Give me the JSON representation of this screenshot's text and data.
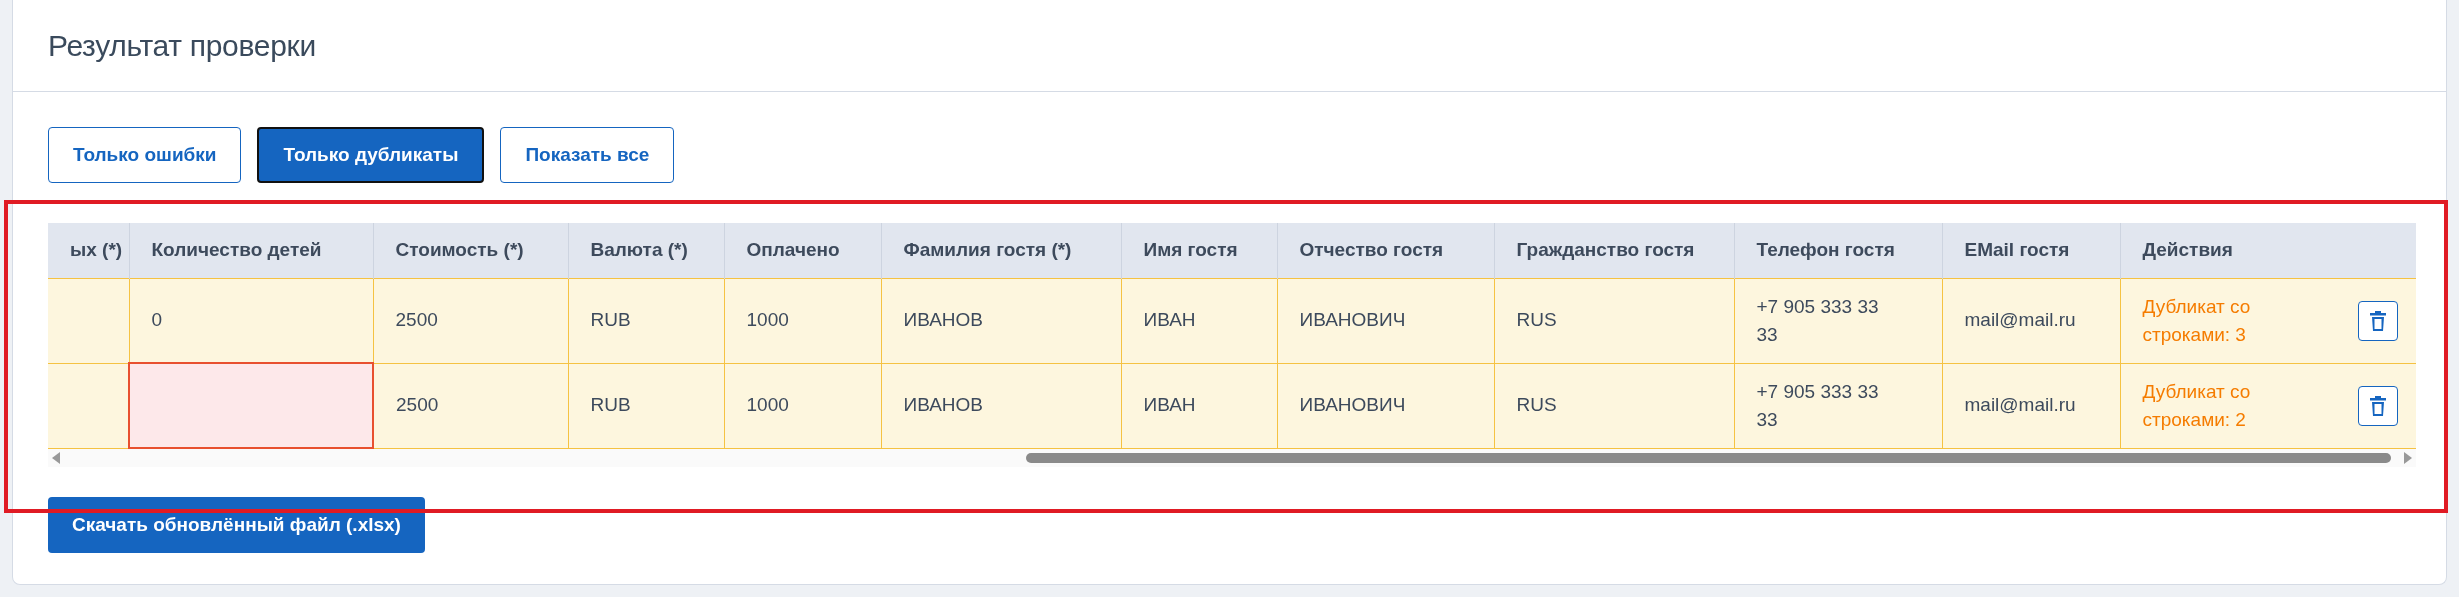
{
  "title": "Результат проверки",
  "filters": [
    {
      "label": "Только ошибки",
      "selected": false
    },
    {
      "label": "Только дубликаты",
      "selected": true
    },
    {
      "label": "Показать все",
      "selected": false
    }
  ],
  "table": {
    "columns": [
      "ых (*)",
      "Количество детей",
      "Стоимость (*)",
      "Валюта (*)",
      "Оплачено",
      "Фамилия гостя (*)",
      "Имя гостя",
      "Отчество гостя",
      "Гражданство гостя",
      "Телефон гостя",
      "EMail гостя",
      "Действия"
    ],
    "rows": [
      {
        "cells": [
          {
            "error": false
          },
          {
            "text": "0",
            "error": false
          },
          {
            "text": "2500",
            "error": false
          },
          {
            "text": "RUB",
            "error": false
          },
          {
            "text": "1000",
            "error": false
          },
          {
            "text": "ИВАНОВ",
            "error": false
          },
          {
            "text": "ИВАН",
            "error": false
          },
          {
            "text": "ИВАНОВИЧ",
            "error": false
          },
          {
            "text": "RUS",
            "error": false
          },
          {
            "text": "+7 905 333 33 33",
            "error": false
          },
          {
            "text": "mail@mail.ru",
            "error": false
          }
        ],
        "status": "Дубликат со строками: 3"
      },
      {
        "cells": [
          {
            "error": false
          },
          {
            "error": true
          },
          {
            "text": "2500",
            "error": false
          },
          {
            "text": "RUB",
            "error": false
          },
          {
            "text": "1000",
            "error": false
          },
          {
            "text": "ИВАНОВ",
            "error": false
          },
          {
            "text": "ИВАН",
            "error": false
          },
          {
            "text": "ИВАНОВИЧ",
            "error": false
          },
          {
            "text": "RUS",
            "error": false
          },
          {
            "text": "+7 905 333 33 33",
            "error": false
          },
          {
            "text": "mail@mail.ru",
            "error": false
          }
        ],
        "status": "Дубликат со строками: 2"
      }
    ]
  },
  "download_button": "Скачать обновлённый файл (.xlsx)"
}
